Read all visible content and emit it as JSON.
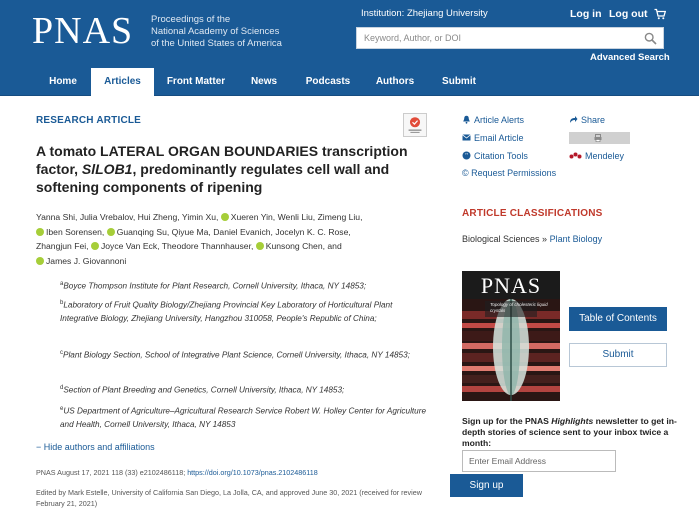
{
  "header": {
    "logo": "PNAS",
    "tagline": [
      "Proceedings of the",
      "National Academy of Sciences",
      "of the United States of America"
    ],
    "institution": "Institution: Zhejiang University",
    "login": "Log in",
    "logout": "Log out",
    "search_placeholder": "Keyword, Author, or DOI",
    "advanced_search": "Advanced Search",
    "bg_color": "#1a5a96"
  },
  "nav": {
    "items": [
      "Home",
      "Articles",
      "Front Matter",
      "News",
      "Podcasts",
      "Authors",
      "Submit"
    ],
    "active": "Articles"
  },
  "article": {
    "section": "RESEARCH ARTICLE",
    "title_prefix": "A tomato LATERAL ORGAN BOUNDARIES transcription factor, ",
    "title_gene": "SlLOB1",
    "title_suffix": ", predominantly regulates cell wall and softening components of ripening",
    "authors": [
      "Yanna Shi,",
      "Julia Vrebalov,",
      "Hui Zheng,",
      "Yimin Xu,",
      "Xueren Yin,",
      "Wenli Liu,",
      "Zimeng Liu,",
      "Iben Sorensen,",
      "Guanqing Su,",
      "Qiyue Ma,",
      "Daniel Evanich,",
      "Jocelyn K. C. Rose,",
      "Zhangjun Fei,",
      "Joyce Van Eck,",
      "Theodore Thannhauser,",
      "Kunsong Chen,",
      "and",
      "James J. Giovannoni"
    ],
    "affiliations": [
      {
        "mark": "a",
        "text": "Boyce Thompson Institute for Plant Research, Cornell University, Ithaca, NY 14853;"
      },
      {
        "mark": "b",
        "text": "Laboratory of Fruit Quality Biology/Zhejiang Provincial Key Laboratory of Horticultural Plant Integrative Biology, Zhejiang University, Hangzhou 310058, People's Republic of China;"
      },
      {
        "mark": "c",
        "text": "Plant Biology Section, School of Integrative Plant Science, Cornell University, Ithaca, NY 14853;"
      },
      {
        "mark": "d",
        "text": "Section of Plant Breeding and Genetics, Cornell University, Ithaca, NY 14853;"
      },
      {
        "mark": "e",
        "text": "US Department of Agriculture–Agricultural Research Service Robert W. Holley Center for Agriculture and Health, Cornell University, Ithaca, NY 14853"
      }
    ],
    "hide_authors": "− Hide authors and affiliations",
    "citation": "PNAS August 17, 2021 118 (33) e2102486118; ",
    "doi": "https://doi.org/10.1073/pnas.2102486118",
    "edited": "Edited by Mark Estelle, University of California San Diego, La Jolla, CA, and approved June 30, 2021 (received for review February 21, 2021)"
  },
  "tools": {
    "article_alerts": "Article Alerts",
    "email_article": "Email Article",
    "citation_tools": "Citation Tools",
    "request_permissions": "© Request Permissions",
    "share": "Share",
    "mendeley": "Mendeley"
  },
  "classifications": {
    "heading": "ARTICLE CLASSIFICATIONS",
    "category": "Biological Sciences",
    "separator": " » ",
    "subcategory": "Plant Biology",
    "heading_color": "#c0392b"
  },
  "cover": {
    "title": "PNAS",
    "subtitle": "Topology of cholesteric liquid crystals"
  },
  "buttons": {
    "toc": "Table of Contents",
    "submit": "Submit"
  },
  "newsletter": {
    "text_prefix": "Sign up for the PNAS ",
    "text_em": "Highlights",
    "text_suffix": " newsletter to get in-depth stories of science sent to your inbox twice a month:",
    "placeholder": "Enter Email Address",
    "button": "Sign up"
  }
}
